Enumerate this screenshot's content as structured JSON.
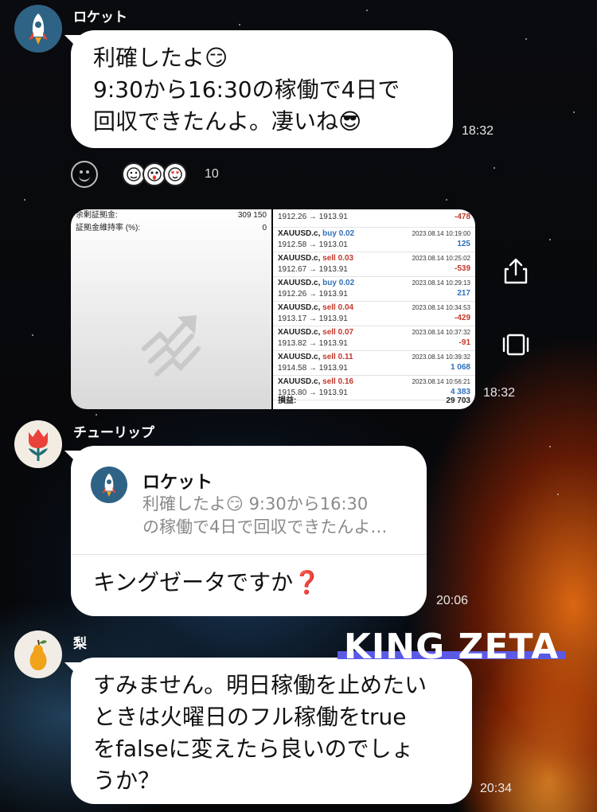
{
  "messages": [
    {
      "sender": "ロケット",
      "text": "利確したよ😏\n9:30から16:30の稼働で4日で\n回収できたんよ。凄いね😎",
      "time": "18:32",
      "reactions": [
        "thumbs-up-face",
        "surprised-face",
        "heart-eyes-face"
      ],
      "reaction_count": "10"
    },
    {
      "sender": "ロケット",
      "time": "18:32",
      "screenshot": {
        "account": [
          {
            "label": "余剰証拠金:",
            "value": "309 150"
          },
          {
            "label": "証拠金維持率 (%):",
            "value": "0"
          }
        ],
        "trades": [
          {
            "symbol": "",
            "side": "",
            "volume": "",
            "date": "",
            "prices": "1912.26 → 1913.91",
            "pnl": "-478",
            "pnl_sign": "neg"
          },
          {
            "symbol": "XAUUSD.c,",
            "side": "buy",
            "volume": "0.02",
            "date": "2023.08.14 10:19:00",
            "prices": "1912.58 → 1913.01",
            "pnl": "125",
            "pnl_sign": "pos"
          },
          {
            "symbol": "XAUUSD.c,",
            "side": "sell",
            "volume": "0.03",
            "date": "2023.08.14 10:25:02",
            "prices": "1912.67 → 1913.91",
            "pnl": "-539",
            "pnl_sign": "neg"
          },
          {
            "symbol": "XAUUSD.c,",
            "side": "buy",
            "volume": "0.02",
            "date": "2023.08.14 10:29:13",
            "prices": "1912.26 → 1913.91",
            "pnl": "217",
            "pnl_sign": "pos"
          },
          {
            "symbol": "XAUUSD.c,",
            "side": "sell",
            "volume": "0.04",
            "date": "2023.08.14 10:34:53",
            "prices": "1913.17 → 1913.91",
            "pnl": "-429",
            "pnl_sign": "neg"
          },
          {
            "symbol": "XAUUSD.c,",
            "side": "sell",
            "volume": "0.07",
            "date": "2023.08.14 10:37:32",
            "prices": "1913.82 → 1913.91",
            "pnl": "-91",
            "pnl_sign": "neg"
          },
          {
            "symbol": "XAUUSD.c,",
            "side": "sell",
            "volume": "0.11",
            "date": "2023.08.14 10:39:32",
            "prices": "1914.58 → 1913.91",
            "pnl": "1 068",
            "pnl_sign": "pos"
          },
          {
            "symbol": "XAUUSD.c,",
            "side": "sell",
            "volume": "0.16",
            "date": "2023.08.14 10:56:21",
            "prices": "1915.80 → 1913.91",
            "pnl": "4 383",
            "pnl_sign": "pos"
          }
        ],
        "footer_label": "損益:",
        "footer_value": "29 703"
      }
    },
    {
      "sender": "チューリップ",
      "quote_sender": "ロケット",
      "quote_text": "利確したよ😏 9:30から16:30\nの稼働で4日で回収できたんよ…",
      "text": "キングゼータですか❓",
      "time": "20:06"
    },
    {
      "sender": "梨",
      "text": "すみません。明日稼働を止めたい\nときは火曜日のフル稼働をtrue\nをfalseに変えたら良いのでしょ\nうか？",
      "time": "20:34"
    }
  ],
  "watermark": "KING ZETA",
  "colors": {
    "bubble": "#ffffff",
    "watermark_strip": "#5a5ae6",
    "sell": "#c0392b",
    "buy": "#2f6fb8"
  },
  "icons": {
    "share": "share-icon",
    "expand": "expand-icon",
    "add_reaction": "add-reaction-icon"
  }
}
